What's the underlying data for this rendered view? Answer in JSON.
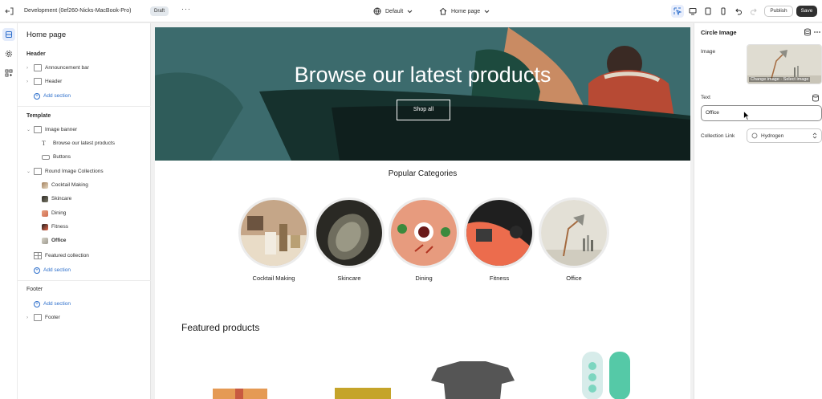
{
  "topbar": {
    "store_name": "Development (0ef260-Nicks-MacBook-Pro)",
    "status_badge": "Draft",
    "more_label": "···",
    "theme_select": "Default",
    "page_select": "Home page",
    "publish_label": "Publish",
    "save_label": "Save"
  },
  "sidebar": {
    "title": "Home page",
    "header_group": "Header",
    "header_items": [
      "Announcement bar",
      "Header"
    ],
    "add_section": "Add section",
    "template_group": "Template",
    "image_banner": "Image banner",
    "image_banner_children": [
      "Browse our latest products",
      "Buttons"
    ],
    "round_collections": "Round Image Collections",
    "round_collections_children": [
      "Cocktail Making",
      "Skincare",
      "Dining",
      "Fitness",
      "Office"
    ],
    "featured_collection": "Featured collection",
    "footer_group": "Footer",
    "footer_item": "Footer"
  },
  "preview": {
    "hero_title": "Browse our latest products",
    "hero_button": "Shop all",
    "categories_heading": "Popular Categories",
    "categories": [
      "Cocktail Making",
      "Skincare",
      "Dining",
      "Fitness",
      "Office"
    ],
    "featured_heading": "Featured products"
  },
  "rpanel": {
    "title": "Circle Image",
    "image_label": "Image",
    "image_caption": "Change image · Select image",
    "text_label": "Text",
    "text_value": "Office",
    "collection_label": "Collection Link",
    "collection_value": "Hydrogen"
  },
  "colors": {
    "accent": "#2c6ecb",
    "hero_bg": "#3c6b6d",
    "save_bg": "#303030"
  }
}
